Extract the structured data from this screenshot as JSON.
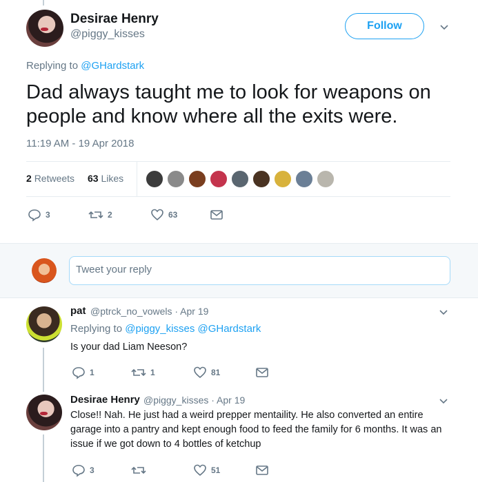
{
  "main_tweet": {
    "author_name": "Desirae Henry",
    "author_handle": "@piggy_kisses",
    "follow_label": "Follow",
    "replying_prefix": "Replying to",
    "replying_to": "@GHardstark",
    "text": "Dad always taught me to look for weapons on people and know where all the exits were.",
    "timestamp": "11:19 AM - 19 Apr 2018",
    "retweets_count": "2",
    "retweets_label": "Retweets",
    "likes_count": "63",
    "likes_label": "Likes",
    "actions": {
      "reply": "3",
      "retweet": "2",
      "like": "63"
    }
  },
  "compose": {
    "placeholder": "Tweet your reply"
  },
  "replies": [
    {
      "author_name": "pat",
      "meta": "@ptrck_no_vowels · Apr 19",
      "replying_prefix": "Replying to",
      "replying_to": "@piggy_kisses @GHardstark",
      "text": "Is your dad Liam Neeson?",
      "actions": {
        "reply": "1",
        "retweet": "1",
        "like": "81"
      }
    },
    {
      "author_name": "Desirae Henry",
      "meta": "@piggy_kisses · Apr 19",
      "text": "Close!! Nah. He just had a weird prepper mentaility. He also converted an entire garage into a pantry and kept enough food to feed the family for 6 months. It was an issue if we got down to 4 bottles of ketchup",
      "actions": {
        "reply": "3",
        "retweet": "",
        "like": "51"
      }
    }
  ],
  "colors": {
    "accent": "#1da1f2",
    "muted": "#657786",
    "text": "#14171a",
    "like": "#e0245e"
  },
  "icons": [
    "chevron-down-icon",
    "reply-icon",
    "retweet-icon",
    "heart-icon",
    "message-icon"
  ]
}
